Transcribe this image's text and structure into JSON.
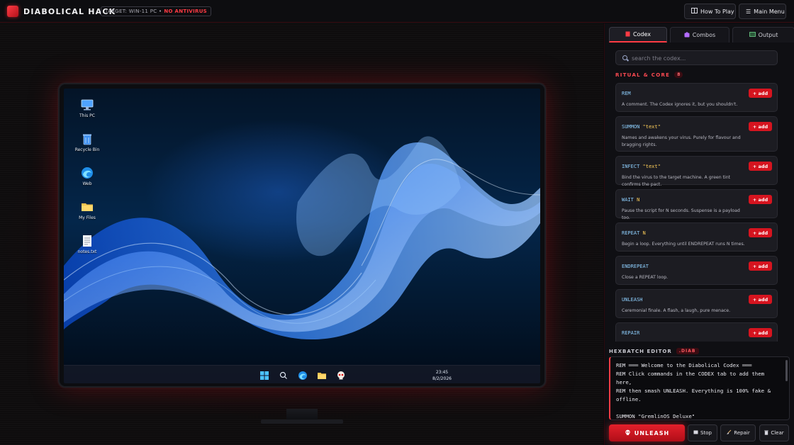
{
  "header": {
    "brand": "DIABOLICAL HACK",
    "target_label": "TARGET: WIN-11 PC •",
    "target_warning": "NO ANTIVIRUS",
    "buttons": {
      "how_to_play": "How To Play",
      "main_menu": "Main Menu"
    },
    "icons": {
      "how_to_play": "book-icon",
      "main_menu": "hamburger-icon"
    }
  },
  "desktop": {
    "icons": [
      {
        "label": "This PC",
        "icon": "monitor-icon"
      },
      {
        "label": "Recycle Bin",
        "icon": "recycle-bin-icon"
      },
      {
        "label": "Web",
        "icon": "browser-icon"
      },
      {
        "label": "My Files",
        "icon": "folder-icon"
      },
      {
        "label": "notes.txt",
        "icon": "text-file-icon"
      }
    ],
    "taskbar": {
      "icons": [
        "start-icon",
        "search-icon",
        "browser-icon",
        "folder-icon",
        "skull-icon"
      ],
      "time": "23:45",
      "date": "8/2/2026"
    }
  },
  "panel": {
    "tabs": [
      {
        "label": "Codex",
        "icon": "book-icon",
        "active": true
      },
      {
        "label": "Combos",
        "icon": "puzzle-icon",
        "active": false
      },
      {
        "label": "Output",
        "icon": "terminal-icon",
        "active": false
      }
    ],
    "search": {
      "placeholder": "search the codex...",
      "value": ""
    },
    "section": {
      "title": "RITUAL & CORE",
      "count": "8"
    },
    "add_label": "+ add",
    "commands": [
      {
        "cmd": "REM",
        "arg": "",
        "desc": "A comment. The Codex ignores it, but you shouldn't."
      },
      {
        "cmd": "SUMMON",
        "arg": "\"text\"",
        "desc": "Names and awakens your virus. Purely for flavour and bragging rights."
      },
      {
        "cmd": "INFECT",
        "arg": "\"text\"",
        "desc": "Bind the virus to the target machine. A green tint confirms the pact."
      },
      {
        "cmd": "WAIT",
        "arg": "N",
        "desc": "Pause the script for N seconds. Suspense is a payload too."
      },
      {
        "cmd": "REPEAT",
        "arg": "N",
        "desc": "Begin a loop. Everything until ENDREPEAT runs N times."
      },
      {
        "cmd": "ENDREPEAT",
        "arg": "",
        "desc": "Close a REPEAT loop."
      },
      {
        "cmd": "UNLEASH",
        "arg": "",
        "desc": "Ceremonial finale. A flash, a laugh, pure menace."
      },
      {
        "cmd": "REPAIR",
        "arg": "",
        "desc": ""
      }
    ],
    "editor": {
      "title": "HEXBATCH EDITOR",
      "ext": ".DIAB",
      "code": "REM ═══ Welcome to the Diabolical Codex ═══\nREM Click commands in the CODEX tab to add them here,\nREM then smash UNLEASH. Everything is 100% fake & offline.\n\nSUMMON \"GremlinOS Deluxe\""
    },
    "actions": {
      "unleash": "UNLEASH",
      "stop": "Stop",
      "repair": "Repair",
      "clear": "Clear"
    }
  },
  "colors": {
    "accent": "#ff3b44",
    "button_red": "#d6141f",
    "command": "#8fd0ff",
    "argument": "#ffcf5a"
  }
}
